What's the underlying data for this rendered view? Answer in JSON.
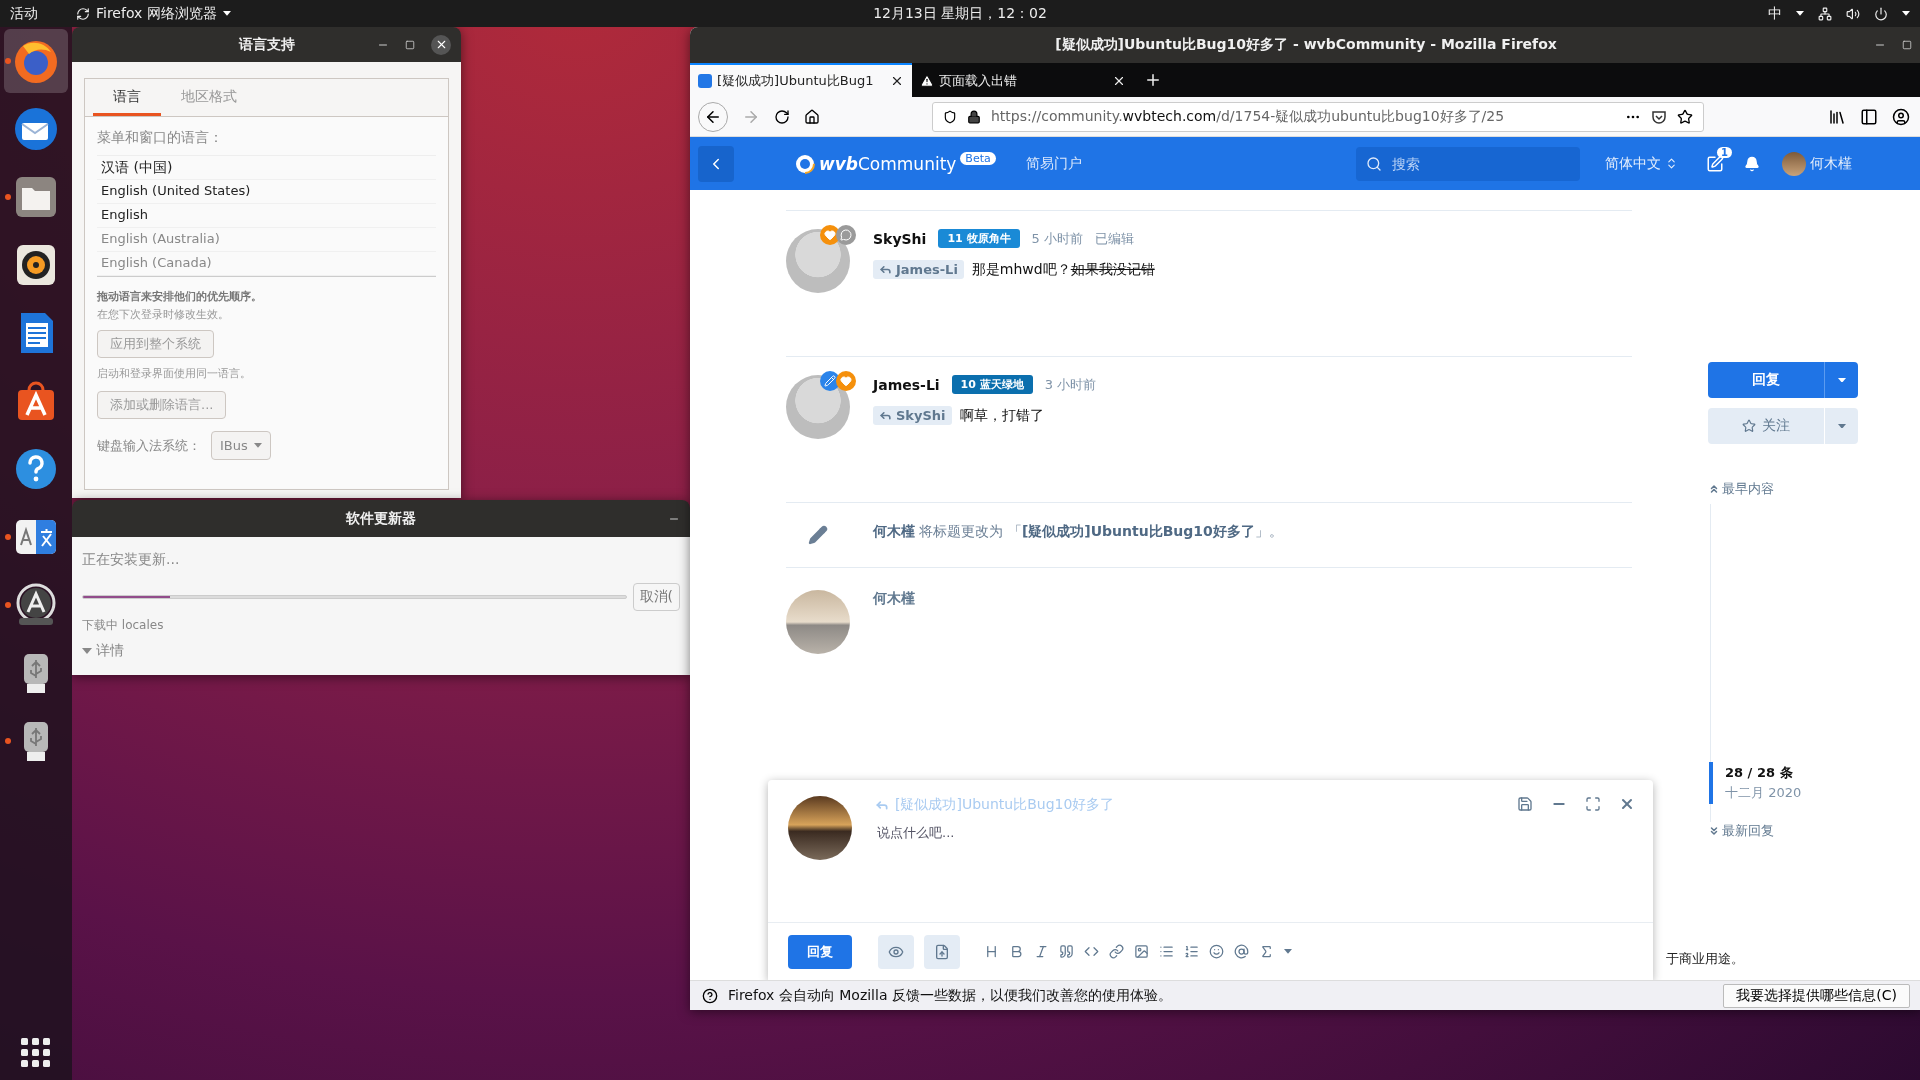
{
  "top_bar": {
    "activities": "活动",
    "app_menu": "Firefox 网络浏览器",
    "clock": "12月13日 星期日，12：02",
    "input_method": "中"
  },
  "dock": [
    {
      "kind": "firefox",
      "running": true,
      "selected": true
    },
    {
      "kind": "mail",
      "running": false,
      "selected": false
    },
    {
      "kind": "files",
      "running": true,
      "selected": false
    },
    {
      "kind": "music",
      "running": false,
      "selected": false
    },
    {
      "kind": "writer",
      "running": false,
      "selected": false
    },
    {
      "kind": "store",
      "running": false,
      "selected": false
    },
    {
      "kind": "help",
      "running": false,
      "selected": false
    },
    {
      "kind": "language",
      "running": true,
      "selected": false
    },
    {
      "kind": "updater",
      "running": true,
      "selected": false
    },
    {
      "kind": "usb",
      "running": false,
      "selected": false
    },
    {
      "kind": "usb",
      "running": true,
      "selected": false
    }
  ],
  "language_window": {
    "title": "语言支持",
    "tabs": [
      {
        "label": "语言",
        "selected": true
      },
      {
        "label": "地区格式",
        "selected": false
      }
    ],
    "list_heading": "菜单和窗口的语言：",
    "languages": [
      {
        "label": "汉语 (中国)",
        "enabled": true
      },
      {
        "label": "English (United States)",
        "enabled": true
      },
      {
        "label": "English",
        "enabled": true
      },
      {
        "label": "English (Australia)",
        "enabled": false
      },
      {
        "label": "English (Canada)",
        "enabled": false
      }
    ],
    "drag_hint": "拖动语言来安排他们的优先顺序。",
    "drag_note": "在您下次登录时修改生效。",
    "apply_button": "应用到整个系统",
    "apply_note": "启动和登录界面使用同一语言。",
    "add_button": "添加或删除语言...",
    "keyboard_label": "键盘输入法系统：",
    "keyboard_value": "IBus"
  },
  "updater_window": {
    "title": "软件更新器",
    "status": "正在安装更新...",
    "progress": {
      "level": 0.16
    },
    "cancel_button": "取消(",
    "detail": "下载中 locales",
    "expander": "详情"
  },
  "firefox": {
    "title": "[疑似成功]Ubuntu比Bug10好多了 - wvbCommunity - Mozilla Firefox",
    "tabs": [
      {
        "kind": "page",
        "label": "[疑似成功]Ubuntu比Bug1",
        "selected": true
      },
      {
        "kind": "warning",
        "label": "页面载入出错",
        "selected": false
      }
    ],
    "url": {
      "prefix": "https://community.",
      "domain": "wvbtech.com",
      "path": "/d/1754-疑似成功ubuntu比bug10好多了/25"
    },
    "site": {
      "logo_prefix": "wvb",
      "logo_name": "Community",
      "logo_badge": "Beta",
      "nav_link": "简易门户",
      "search_placeholder": "搜索",
      "language": "简体中文",
      "notification_count": "1",
      "user": "何木槿"
    },
    "stream": [
      {
        "kind": "comment",
        "author": "SkyShi",
        "avatar_badges": [
          {
            "kind": "heart"
          },
          {
            "kind": "chat"
          }
        ],
        "badge": "11 牧原角牛",
        "color": "#1a8ad6",
        "time": "5 小时前",
        "edited": "已编辑",
        "reply_to": "James-Li",
        "text": "那是mhwd吧？",
        "struck_text": "如果我没记错"
      },
      {
        "kind": "comment",
        "author": "James-Li",
        "avatar_badges": [
          {
            "kind": "pencil"
          },
          {
            "kind": "heart"
          }
        ],
        "badge": "10 蓝天绿地",
        "color": "#0b6fae",
        "time": "3 小时前",
        "reply_to": "SkyShi",
        "text": "啊草，打错了"
      },
      {
        "kind": "event",
        "text": "**何木槿** 将标题更改为 「**[疑似成功]Ubuntu比Bug10好多了**」。"
      },
      {
        "kind": "draft",
        "author": "何木槿"
      }
    ],
    "sidebar": {
      "reply_button": "回复",
      "follow_button": "关注",
      "earliest": "最早内容",
      "position": "28 / 28 条",
      "date": "十二月 2020",
      "latest": "最新回复"
    },
    "composer": {
      "reply_title": "[疑似成功]Ubuntu比Bug10好多了",
      "placeholder": "说点什么吧...",
      "submit": "回复"
    },
    "footer_tail": "于商业用途。",
    "notification_bar": {
      "message": "Firefox 会自动向 Mozilla 反馈一些数据，以便我们改善您的使用体验。",
      "button": "我要选择提供哪些信息(C)"
    }
  }
}
